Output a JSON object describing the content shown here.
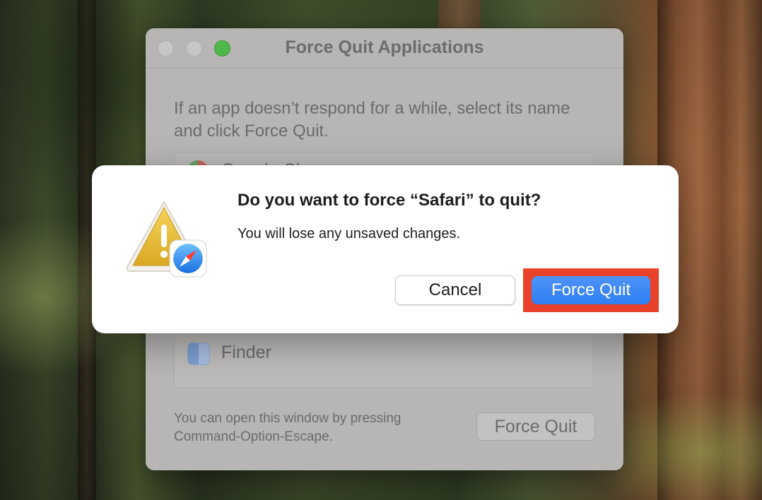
{
  "colors": {
    "accent_blue": "#2f7ef2",
    "highlight_red": "#e8432a",
    "zoom_green": "#4fb84a"
  },
  "window": {
    "title": "Force Quit Applications",
    "instructions": "If an app doesn’t respond for a while, select its name and click Force Quit.",
    "apps": [
      {
        "name": "Google Chrome",
        "icon": "chrome-icon"
      },
      {
        "name": "Finder",
        "icon": "finder-icon"
      }
    ],
    "footer": "You can open this window by pressing Command-Option-Escape.",
    "force_quit_label": "Force Quit"
  },
  "alert": {
    "icon": "warning-icon",
    "badge_icon": "safari-icon",
    "title": "Do you want to force “Safari” to quit?",
    "message": "You will lose any unsaved changes.",
    "cancel_label": "Cancel",
    "confirm_label": "Force Quit"
  }
}
